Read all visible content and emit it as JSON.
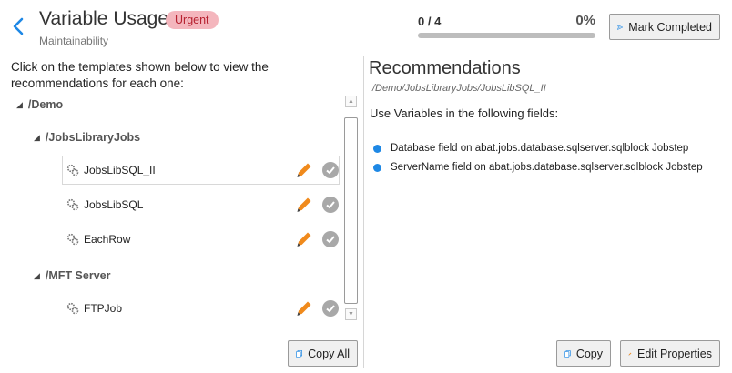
{
  "header": {
    "title": "Variable Usage",
    "badge": "Urgent",
    "subtitle": "Maintainability",
    "progress_count": "0 / 4",
    "progress_percent": "0%",
    "progress_fraction": 0,
    "mark_completed_label": "Mark Completed",
    "colors": {
      "badge_bg": "#f4b6bd",
      "badge_text": "#b6202f",
      "accent": "#1e88e5"
    }
  },
  "left": {
    "instructions": "Click on the templates shown below to view the recommendations for each one:",
    "tree": {
      "root": "/Demo",
      "folders": [
        {
          "label": "/JobsLibraryJobs",
          "templates": [
            {
              "name": "JobsLibSQL_II",
              "selected": true
            },
            {
              "name": "JobsLibSQL",
              "selected": false
            },
            {
              "name": "EachRow",
              "selected": false
            }
          ]
        },
        {
          "label": "/MFT Server",
          "templates": [
            {
              "name": "FTPJob",
              "selected": false
            }
          ]
        }
      ]
    },
    "copy_all_label": "Copy All"
  },
  "right": {
    "title": "Recommendations",
    "path": "/Demo/JobsLibraryJobs/JobsLibSQL_II",
    "intro": "Use Variables in the following fields:",
    "items": [
      "Database field on abat.jobs.database.sqlserver.sqlblock Jobstep",
      "ServerName field on abat.jobs.database.sqlserver.sqlblock Jobstep"
    ],
    "copy_label": "Copy",
    "edit_label": "Edit Properties"
  }
}
